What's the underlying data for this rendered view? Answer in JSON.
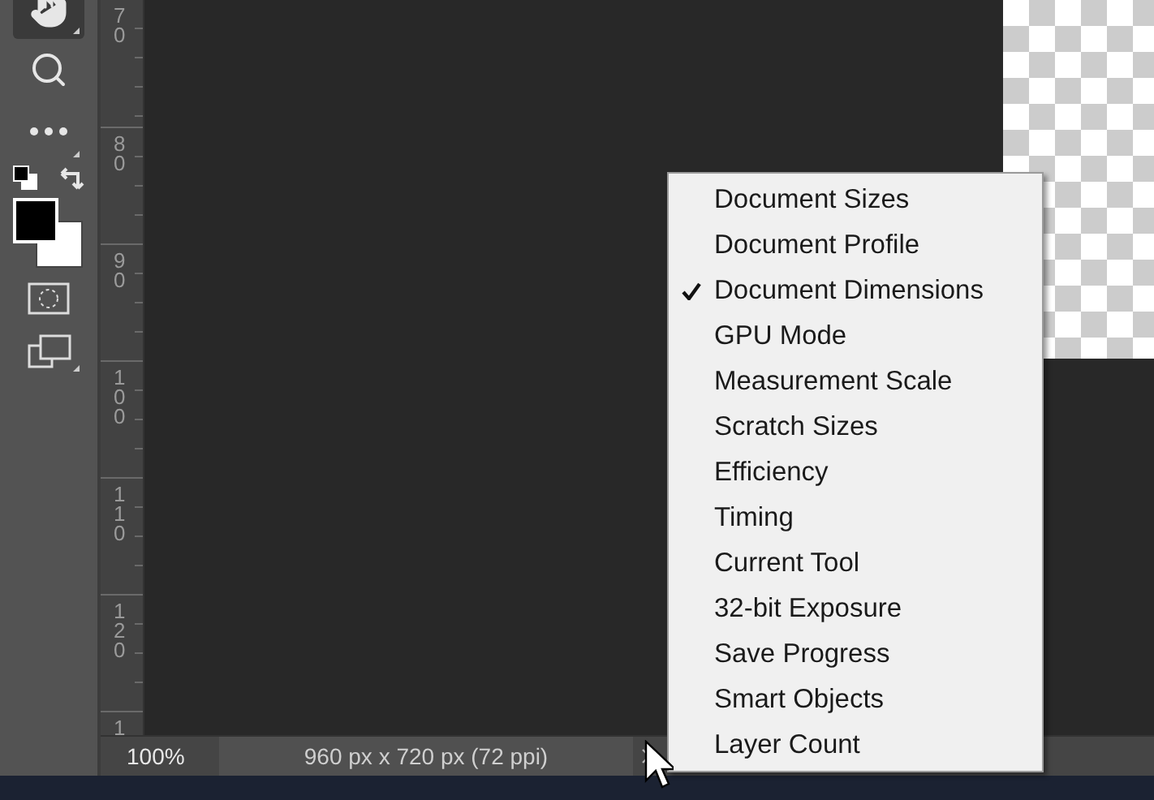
{
  "ruler": {
    "labels": [
      "70",
      "80",
      "90",
      "100",
      "110",
      "120",
      "1"
    ]
  },
  "status_bar": {
    "zoom": "100%",
    "document_info": "960 px x 720 px (72 ppi)"
  },
  "menu": {
    "items": [
      {
        "label": "Document Sizes",
        "checked": false
      },
      {
        "label": "Document Profile",
        "checked": false
      },
      {
        "label": "Document Dimensions",
        "checked": true
      },
      {
        "label": "GPU Mode",
        "checked": false
      },
      {
        "label": "Measurement Scale",
        "checked": false
      },
      {
        "label": "Scratch Sizes",
        "checked": false
      },
      {
        "label": "Efficiency",
        "checked": false
      },
      {
        "label": "Timing",
        "checked": false
      },
      {
        "label": "Current Tool",
        "checked": false
      },
      {
        "label": "32-bit Exposure",
        "checked": false
      },
      {
        "label": "Save Progress",
        "checked": false
      },
      {
        "label": "Smart Objects",
        "checked": false
      },
      {
        "label": "Layer Count",
        "checked": false
      }
    ]
  }
}
